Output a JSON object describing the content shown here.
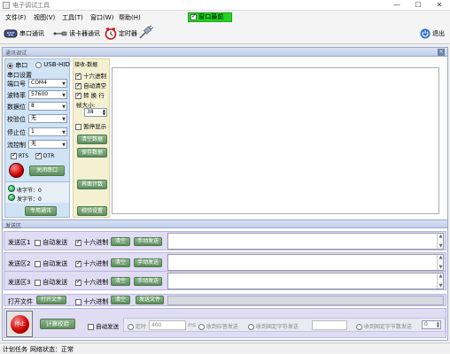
{
  "window": {
    "title": "电子调试工具",
    "minimize": "—",
    "maximize": "☐",
    "close": "✕"
  },
  "menu": {
    "items": [
      "文件(F)",
      "视图(V)",
      "工具(T)",
      "窗口(W)",
      "帮助(H)"
    ],
    "topmost_label": "窗口最前",
    "topmost_checked": true
  },
  "toolbar": {
    "serial": "串口通讯",
    "reader": "读卡器通讯",
    "timer": "定时器",
    "exit": "退出"
  },
  "panel": {
    "title": "通讯调试"
  },
  "port": {
    "mode_serial": "串口",
    "mode_hid": "USB-HID",
    "settings_title": "串口设置",
    "port_label": "端口号",
    "port_value": "COM4",
    "baud_label": "波特率",
    "baud_value": "57600",
    "databits_label": "数据位",
    "databits_value": "8",
    "parity_label": "校验位",
    "parity_value": "无",
    "stopbits_label": "停止位",
    "stopbits_value": "1",
    "flow_label": "流控制",
    "flow_value": "无",
    "rts": "RTS",
    "dtr": "DTR",
    "close_port_btn": "关闭串口",
    "rx_bytes": "收字节：0",
    "tx_bytes": "发字节：0",
    "special_btn": "专用通讯"
  },
  "receive": {
    "title": "接收-数据",
    "hex": "十六进制",
    "auto_clear": "自动清空",
    "wrap": "转 换 行",
    "frame_label": "帧大小:",
    "frame_value": "38",
    "pause": "暂停显示",
    "clear_btn": "清空数据",
    "save_btn": "保存数据",
    "calc_btn": "界面计数",
    "check_btn": "校验设置"
  },
  "send": {
    "title": "发送区",
    "rows": [
      {
        "label": "发送区1",
        "auto": "自动发送",
        "hex": "十六进制",
        "clear": "清空",
        "manual": "手动发送"
      },
      {
        "label": "发送区2",
        "auto": "自动发送",
        "hex": "十六进制",
        "clear": "清空",
        "manual": "手动发送"
      },
      {
        "label": "发送区3",
        "auto": "自动发送",
        "hex": "十六进制",
        "clear": "清空",
        "manual": "手动发送"
      }
    ],
    "open_file_label": "打开文件",
    "open_file_btn": "打开文件",
    "open_file_hex": "十六进制",
    "open_file_clear": "清空",
    "send_file_btn": "发送文件",
    "stop_btn": "停止",
    "calc_check_btn": "计算校验",
    "auto_send": "自动发送",
    "timed": "定时",
    "timed_value": "400",
    "ms": "ms",
    "recv_reply": "收到应答发送",
    "recv_fixed": "收到固定字符发送",
    "recv_fixed_len": "收到固定字节数发送",
    "len_value": "0"
  },
  "status": {
    "task": "计划任务",
    "net": "网络状态：正常"
  },
  "colors": {
    "topmost_green": "#24d424",
    "left_panel": "#cfe3f5",
    "send_row": "#dfdcf3",
    "btn_green": "#6b9b69"
  }
}
